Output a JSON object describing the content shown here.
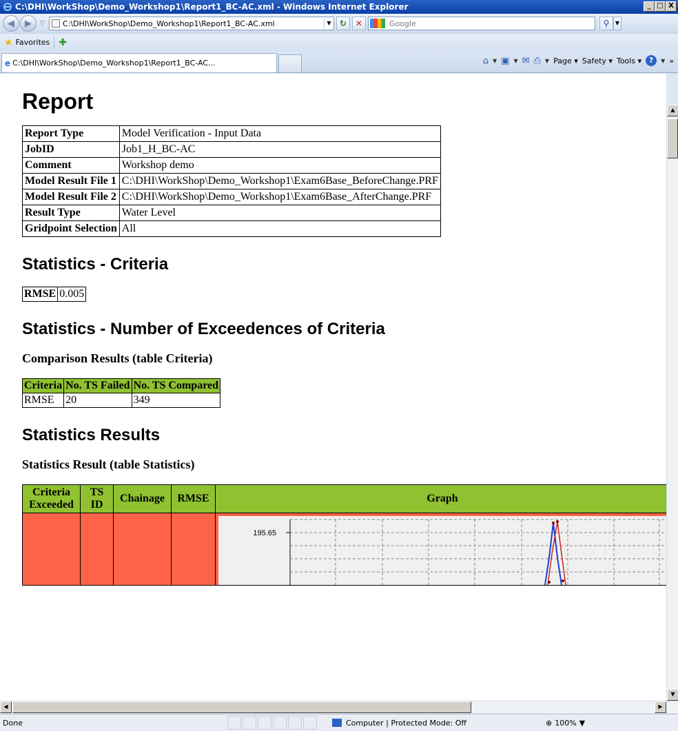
{
  "window": {
    "title": "C:\\DHI\\WorkShop\\Demo_Workshop1\\Report1_BC-AC.xml - Windows Internet Explorer",
    "minimize": "_",
    "maximize": "□",
    "close": "X"
  },
  "nav": {
    "address": "C:\\DHI\\WorkShop\\Demo_Workshop1\\Report1_BC-AC.xml",
    "search_placeholder": "Google"
  },
  "favorites": {
    "label": "Favorites"
  },
  "tab": {
    "title": "C:\\DHI\\WorkShop\\Demo_Workshop1\\Report1_BC-AC..."
  },
  "commands": {
    "page": "Page",
    "safety": "Safety",
    "tools": "Tools"
  },
  "report": {
    "heading": "Report",
    "info_rows": [
      {
        "key": "Report Type",
        "value": "Model Verification - Input Data"
      },
      {
        "key": "JobID",
        "value": "Job1_H_BC-AC"
      },
      {
        "key": "Comment",
        "value": "Workshop demo"
      },
      {
        "key": "Model Result File 1",
        "value": "C:\\DHI\\WorkShop\\Demo_Workshop1\\Exam6Base_BeforeChange.PRF"
      },
      {
        "key": "Model Result File 2",
        "value": "C:\\DHI\\WorkShop\\Demo_Workshop1\\Exam6Base_AfterChange.PRF"
      },
      {
        "key": "Result Type",
        "value": "Water Level"
      },
      {
        "key": "Gridpoint Selection",
        "value": "All"
      }
    ],
    "criteria_heading": "Statistics - Criteria",
    "criteria_key": "RMSE",
    "criteria_value": "0.005",
    "exceed_heading": "Statistics - Number of Exceedences of Criteria",
    "comparison_heading": "Comparison Results (table Criteria)",
    "comparison_headers": [
      "Criteria",
      "No. TS Failed",
      "No. TS Compared"
    ],
    "comparison_row": [
      "RMSE",
      "20",
      "349"
    ],
    "results_heading": "Statistics Results",
    "stats_subheading": "Statistics Result (table Statistics)",
    "stats_headers": [
      "Criteria Exceeded",
      "TS ID",
      "Chainage",
      "RMSE",
      "Graph"
    ],
    "graph_ytick": "195.65"
  },
  "status": {
    "text": "Done",
    "zone": "Computer | Protected Mode: Off",
    "zoom": "100%"
  }
}
